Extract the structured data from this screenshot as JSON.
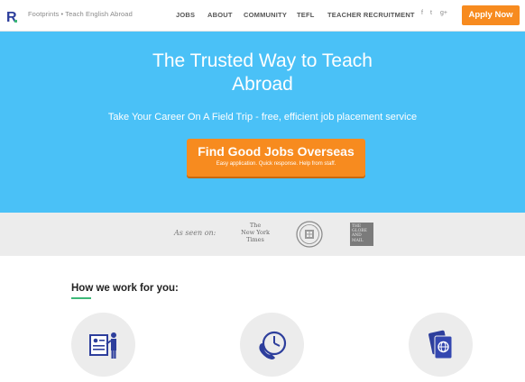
{
  "header": {
    "brand": "Footprints • Teach English Abroad",
    "nav": [
      "JOBS",
      "ABOUT",
      "COMMUNITY",
      "TEFL",
      "TEACHER RECRUITMENT"
    ],
    "social": [
      "f",
      "t",
      "g+"
    ],
    "apply_label": "Apply Now"
  },
  "hero": {
    "title_line1": "The Trusted Way to Teach",
    "title_line2": "Abroad",
    "subtitle": "Take Your Career On A Field Trip - free, efficient job placement service",
    "cta_title": "Find Good Jobs Overseas",
    "cta_subtitle": "Easy application. Quick response. Help from staff."
  },
  "press": {
    "label": "As seen on:",
    "nyt_lines": [
      "The",
      "New York",
      "Times"
    ],
    "globe_lines": [
      "THE",
      "GLOBE",
      "AND",
      "MAIL"
    ]
  },
  "how": {
    "title": "How we work for you:"
  },
  "colors": {
    "hero_bg": "#4ac1f7",
    "accent_orange": "#f78b1f",
    "icon_blue": "#2d3e9c",
    "underline_green": "#3cb878"
  },
  "icons": [
    "logo-r-icon",
    "facebook-icon",
    "twitter-icon",
    "google-plus-icon",
    "resume-presentation-icon",
    "phone-clock-icon",
    "passport-icon"
  ]
}
